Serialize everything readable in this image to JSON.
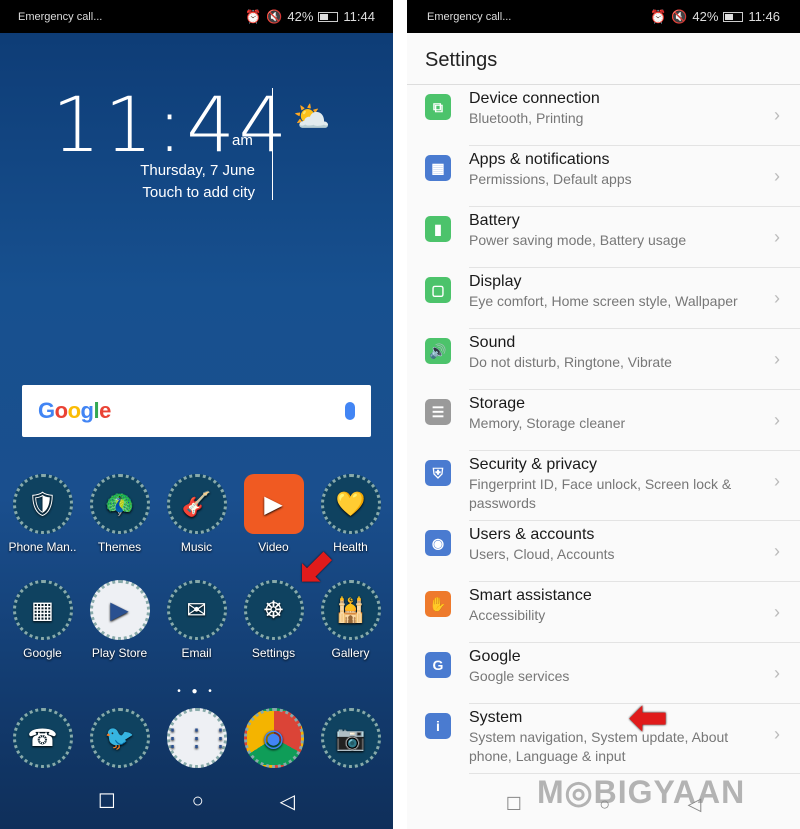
{
  "home": {
    "status": {
      "left": "Emergency call...",
      "battery": "42%",
      "time": "11:44"
    },
    "clock": {
      "time": "11:44",
      "ampm": "am",
      "date": "Thursday, 7 June",
      "city": "Touch to add city",
      "weather_icon": "partly-cloudy-icon"
    },
    "search": {
      "logo": "Google"
    },
    "row1": [
      {
        "label": "Phone Man..",
        "icon": "🛡"
      },
      {
        "label": "Themes",
        "icon": "🦚"
      },
      {
        "label": "Music",
        "icon": "🎸"
      },
      {
        "label": "Video",
        "icon": "▶"
      },
      {
        "label": "Health",
        "icon": "💛"
      }
    ],
    "row2": [
      {
        "label": "Google",
        "icon": "▦"
      },
      {
        "label": "Play Store",
        "icon": "▶"
      },
      {
        "label": "Email",
        "icon": "✉"
      },
      {
        "label": "Settings",
        "icon": "☸"
      },
      {
        "label": "Gallery",
        "icon": "🕌"
      }
    ],
    "dock": [
      {
        "label": "Phone",
        "icon": "☎"
      },
      {
        "label": "Messages",
        "icon": "🐦"
      },
      {
        "label": "Apps",
        "icon": "⋮⋮⋮"
      },
      {
        "label": "Chrome",
        "icon": "◉"
      },
      {
        "label": "Camera",
        "icon": "📷"
      }
    ],
    "page_dots": "• ● •"
  },
  "settings": {
    "status": {
      "left": "Emergency call...",
      "battery": "42%",
      "time": "11:46"
    },
    "title": "Settings",
    "items": [
      {
        "title": "Device connection",
        "sub": "Bluetooth, Printing",
        "color": "#4cc36b",
        "icon": "⧉"
      },
      {
        "title": "Apps & notifications",
        "sub": "Permissions, Default apps",
        "color": "#4a7bd0",
        "icon": "▦"
      },
      {
        "title": "Battery",
        "sub": "Power saving mode, Battery usage",
        "color": "#4cc36b",
        "icon": "▮"
      },
      {
        "title": "Display",
        "sub": "Eye comfort, Home screen style, Wallpaper",
        "color": "#4cc36b",
        "icon": "▢"
      },
      {
        "title": "Sound",
        "sub": "Do not disturb, Ringtone, Vibrate",
        "color": "#4cc36b",
        "icon": "🔊"
      },
      {
        "title": "Storage",
        "sub": "Memory, Storage cleaner",
        "color": "#9a9a9a",
        "icon": "☰"
      },
      {
        "title": "Security & privacy",
        "sub": "Fingerprint ID, Face unlock, Screen lock & passwords",
        "color": "#4a7bd0",
        "icon": "⛨"
      },
      {
        "title": "Users & accounts",
        "sub": "Users, Cloud, Accounts",
        "color": "#4a7bd0",
        "icon": "◉"
      },
      {
        "title": "Smart assistance",
        "sub": "Accessibility",
        "color": "#ee7a2c",
        "icon": "✋"
      },
      {
        "title": "Google",
        "sub": "Google services",
        "color": "#4a7bd0",
        "icon": "G"
      },
      {
        "title": "System",
        "sub": "System navigation, System update, About phone, Language & input",
        "color": "#4a7bd0",
        "icon": "i"
      }
    ],
    "watermark": "MOBIGYAAN"
  }
}
